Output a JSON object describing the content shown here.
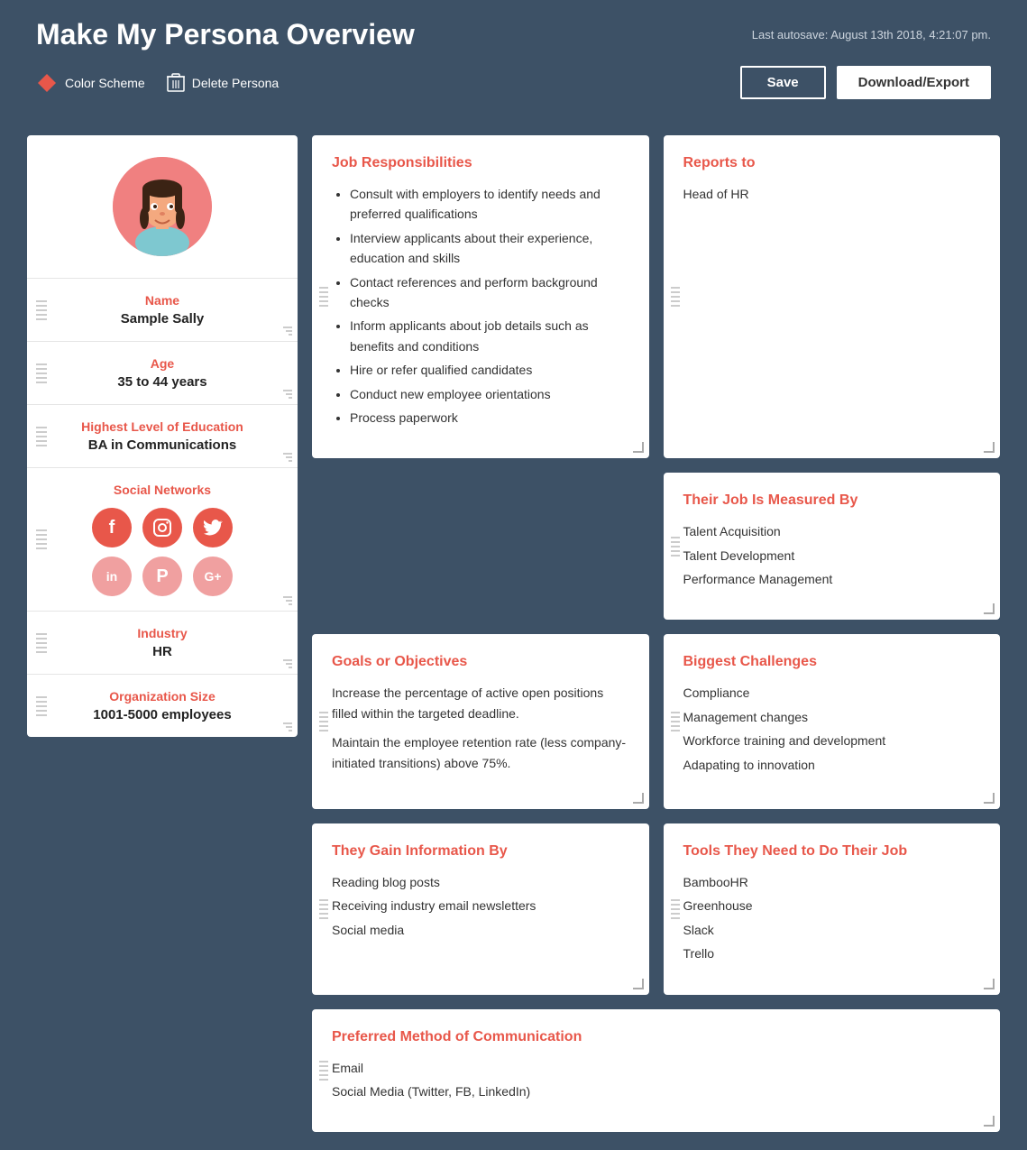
{
  "header": {
    "title": "Make My Persona Overview",
    "autosave": "Last autosave: August 13th 2018, 4:21:07 pm.",
    "color_scheme_label": "Color Scheme",
    "delete_persona_label": "Delete Persona",
    "save_button": "Save",
    "download_button": "Download/Export"
  },
  "persona": {
    "name_label": "Name",
    "name_value": "Sample Sally",
    "age_label": "Age",
    "age_value": "35 to 44 years",
    "education_label": "Highest Level of Education",
    "education_value": "BA in Communications",
    "social_label": "Social Networks",
    "social_icons": [
      "f",
      "📷",
      "🐦",
      "in",
      "P",
      "G+"
    ],
    "industry_label": "Industry",
    "industry_value": "HR",
    "org_size_label": "Organization Size",
    "org_size_value": "1001-5000 employees"
  },
  "cards": {
    "job_responsibilities": {
      "title": "Job Responsibilities",
      "items": [
        "Consult with employers to identify needs and preferred qualifications",
        "Interview applicants about their experience, education and skills",
        "Contact references and perform background checks",
        "Inform applicants about job details such as benefits and conditions",
        "Hire or refer qualified candidates",
        "Conduct new employee orientations",
        "Process paperwork"
      ]
    },
    "reports_to": {
      "title": "Reports to",
      "value": "Head of HR"
    },
    "job_measured_by": {
      "title": "Their Job Is Measured By",
      "items": [
        "Talent Acquisition",
        "Talent Development",
        "Performance Management"
      ]
    },
    "goals": {
      "title": "Goals or Objectives",
      "paragraphs": [
        "Increase the percentage of active open positions filled within the targeted deadline.",
        "Maintain the employee retention rate (less company-initiated transitions) above 75%."
      ]
    },
    "biggest_challenges": {
      "title": "Biggest Challenges",
      "items": [
        "Compliance",
        "Management changes",
        "Workforce training and development",
        "Adapating to innovation"
      ]
    },
    "gain_info": {
      "title": "They Gain Information By",
      "items": [
        "Reading blog posts",
        "Receiving industry email newsletters",
        "Social media"
      ]
    },
    "tools": {
      "title": "Tools They Need to Do Their Job",
      "items": [
        "BambooHR",
        "Greenhouse",
        "Slack",
        "Trello"
      ]
    },
    "communication": {
      "title": "Preferred Method of Communication",
      "items": [
        "Email",
        "Social Media (Twitter, FB, LinkedIn)"
      ]
    }
  }
}
